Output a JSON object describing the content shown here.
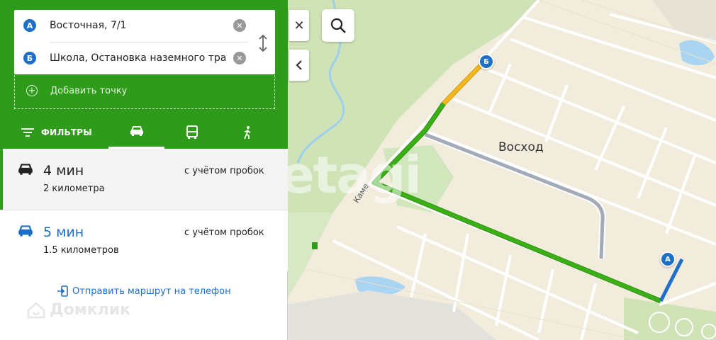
{
  "route": {
    "point_a": {
      "badge": "А",
      "value": "Восточная, 7/1"
    },
    "point_b": {
      "badge": "Б",
      "value": "Школа, Остановка наземного тра"
    },
    "add_point_label": "Добавить точку"
  },
  "tabs": {
    "filters_label": "ФИЛЬТРЫ",
    "active": "car"
  },
  "variants": [
    {
      "time": "4 мин",
      "distance": "2 километра",
      "traffic": "с учётом пробок"
    },
    {
      "time": "5 мин",
      "distance": "1.5 километров",
      "traffic": "с учётом пробок"
    }
  ],
  "send_route_label": "Отправить маршрут на телефон",
  "watermark_logo": "Домклик",
  "watermark_brand": "etagi",
  "map": {
    "district_label": "Восход",
    "street_label": "Каме",
    "marker_a": "А",
    "marker_b": "Б"
  },
  "colors": {
    "panel_green": "#2f9b1a",
    "accent_blue": "#1e6fc7",
    "route_green": "#3ab016",
    "route_yellow": "#f2b61e",
    "route_alt": "#9aa3b0"
  },
  "icons": {
    "close": "close-icon",
    "collapse": "chevron-left-icon",
    "search": "search-icon",
    "swap": "swap-icon",
    "clear": "clear-icon",
    "add": "add-circle-icon",
    "filters": "filter-icon",
    "car": "car-icon",
    "bus": "bus-icon",
    "walk": "walk-icon",
    "send": "send-to-phone-icon"
  }
}
